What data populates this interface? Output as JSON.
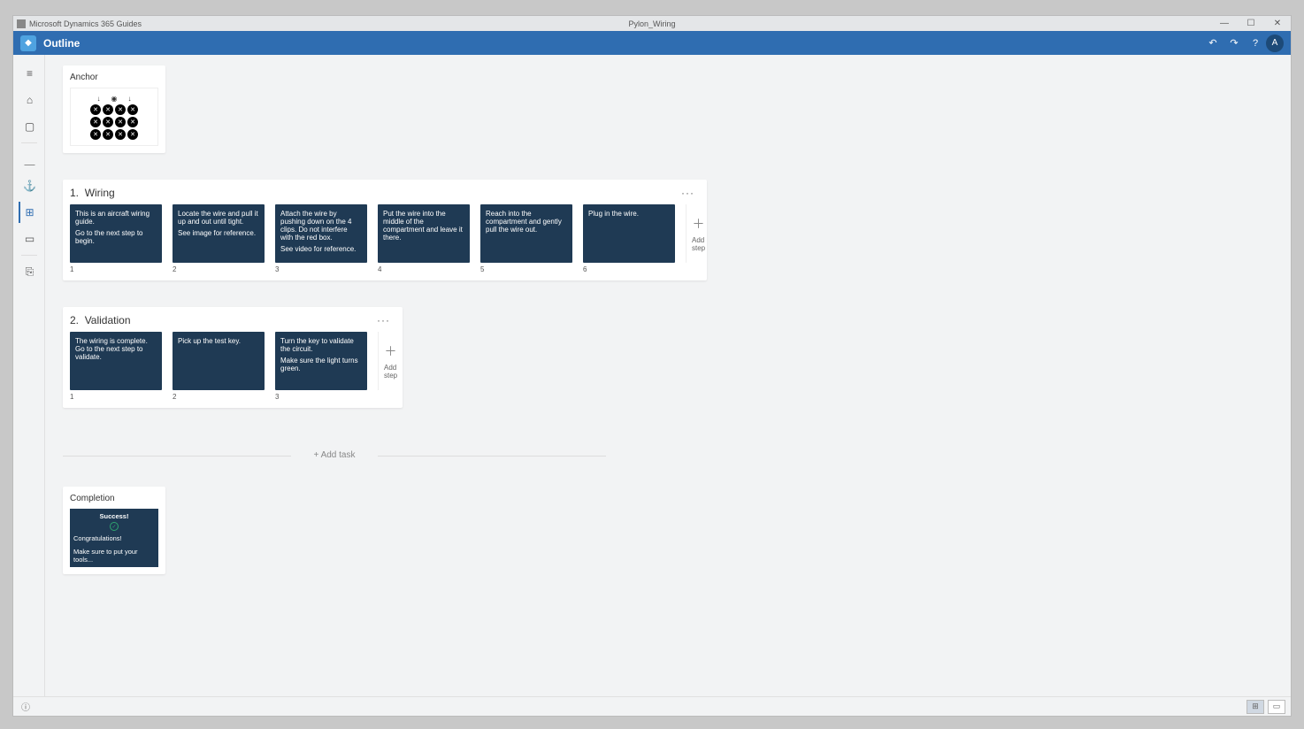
{
  "titlebar": {
    "app_name": "Microsoft Dynamics 365 Guides",
    "doc_name": "Pylon_Wiring"
  },
  "header": {
    "title": "Outline",
    "undo": "↶",
    "redo": "↷",
    "help": "?",
    "avatar": "A"
  },
  "rail": {
    "hamburger": "≡",
    "home": "⌂",
    "image": "▢",
    "anchor": "⚓",
    "outline": "⊞",
    "step": "▭",
    "recent": "⎘",
    "info": "ⓘ"
  },
  "anchor": {
    "label": "Anchor"
  },
  "tasks": [
    {
      "index": "1.",
      "name": "Wiring",
      "more": "···",
      "steps": [
        {
          "num": "1",
          "lines": [
            "This is an aircraft wiring guide.",
            "Go to the next step to begin."
          ]
        },
        {
          "num": "2",
          "lines": [
            "Locate the wire and pull it up and out until tight.",
            "See image for reference."
          ]
        },
        {
          "num": "3",
          "lines": [
            "Attach the wire by pushing down on the 4 clips.  Do not interfere with the red box.",
            "See video for reference."
          ]
        },
        {
          "num": "4",
          "lines": [
            "Put the wire into the middle of the compartment and leave it there."
          ]
        },
        {
          "num": "5",
          "lines": [
            "Reach into the compartment and gently pull the wire out."
          ]
        },
        {
          "num": "6",
          "lines": [
            "Plug in the wire."
          ]
        }
      ],
      "add_step": "Add step"
    },
    {
      "index": "2.",
      "name": "Validation",
      "more": "···",
      "steps": [
        {
          "num": "1",
          "lines": [
            "The wiring is complete. Go to the next step to validate."
          ]
        },
        {
          "num": "2",
          "lines": [
            "Pick up the test key."
          ]
        },
        {
          "num": "3",
          "lines": [
            "Turn the key to validate the circuit.",
            "Make sure the light turns green."
          ]
        }
      ],
      "add_step": "Add step"
    }
  ],
  "add_task": "+  Add task",
  "completion": {
    "label": "Completion",
    "success": "Success!",
    "congrats": "Congratulations!",
    "note": "Make sure to put your tools..."
  },
  "views": {
    "grid": "⊞",
    "step": "▭"
  }
}
